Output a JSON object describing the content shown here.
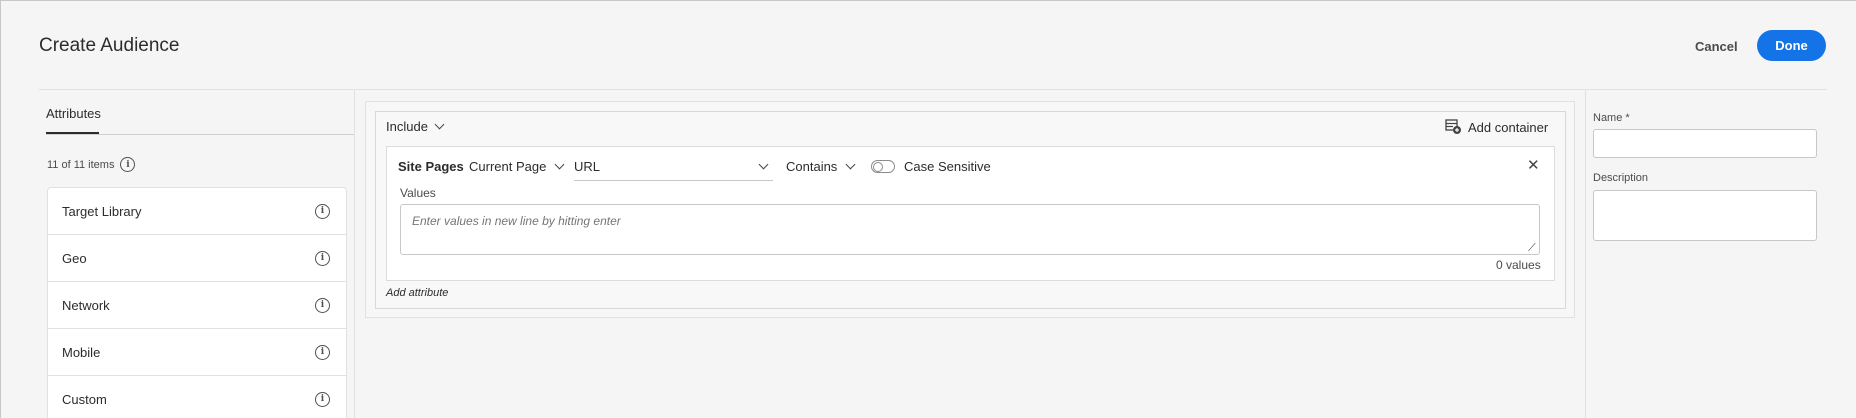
{
  "header": {
    "title": "Create Audience",
    "cancel_label": "Cancel",
    "done_label": "Done"
  },
  "left_panel": {
    "tab_label": "Attributes",
    "item_count": "11 of 11 items",
    "items": [
      {
        "label": "Target Library"
      },
      {
        "label": "Geo"
      },
      {
        "label": "Network"
      },
      {
        "label": "Mobile"
      },
      {
        "label": "Custom"
      }
    ]
  },
  "builder": {
    "include_label": "Include",
    "add_container_label": "Add container",
    "condition": {
      "category": "Site Pages",
      "page_value": "Current Page",
      "field_value": "URL",
      "operator_value": "Contains",
      "case_sensitive_label": "Case Sensitive",
      "case_sensitive_on": false,
      "values_label": "Values",
      "values_placeholder": "Enter values in new line by hitting enter",
      "values_count": "0 values"
    },
    "add_attribute_label": "Add attribute"
  },
  "right_panel": {
    "name_label": "Name *",
    "name_value": "",
    "description_label": "Description",
    "description_value": ""
  },
  "colors": {
    "accent": "#1473e6"
  }
}
